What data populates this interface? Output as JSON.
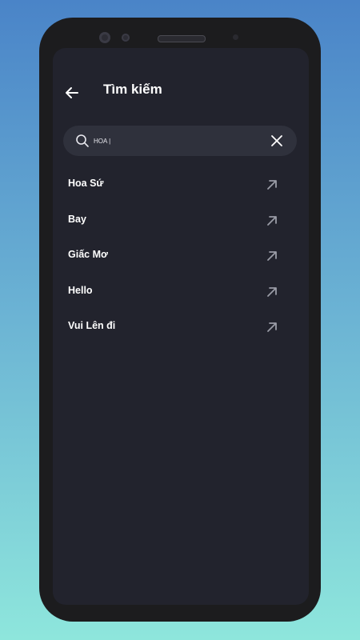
{
  "header": {
    "title": "Tìm kiếm"
  },
  "search": {
    "value": "HOA |"
  },
  "results": [
    {
      "label": "Hoa Sứ"
    },
    {
      "label": "Bay"
    },
    {
      "label": "Giấc Mơ"
    },
    {
      "label": "Hello"
    },
    {
      "label": "Vui Lên đi"
    }
  ],
  "icons": {
    "back": "arrow-left-icon",
    "search": "search-icon",
    "clear": "close-icon",
    "suggestion": "arrow-up-right-icon"
  },
  "colors": {
    "screen_bg": "#22232d",
    "search_bg": "#2f313c",
    "text": "#ffffff",
    "icon_muted": "#9a9ca6"
  }
}
